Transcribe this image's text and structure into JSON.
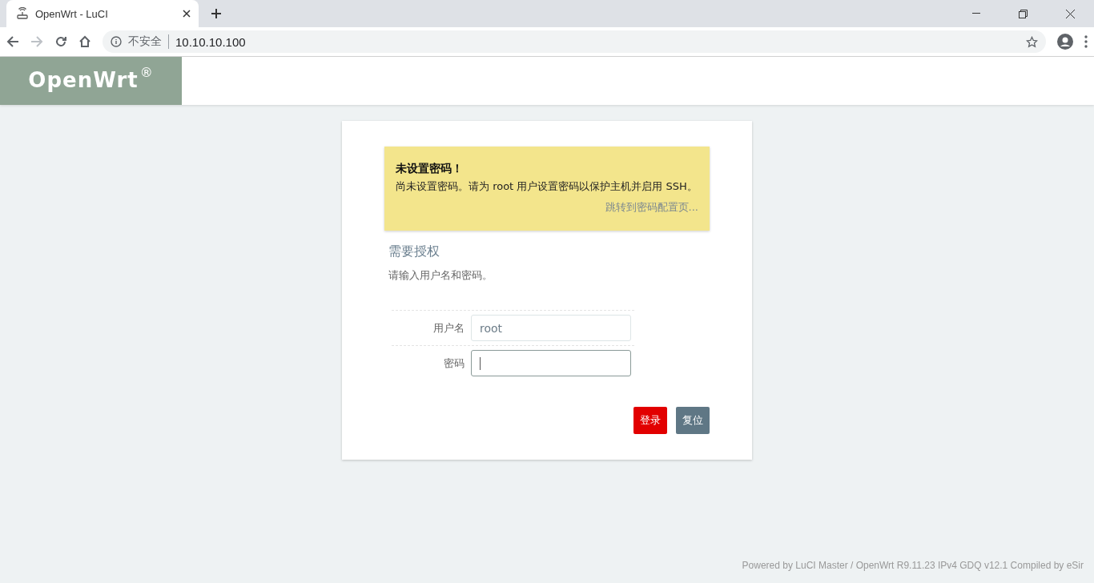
{
  "browser": {
    "tab_title": "OpenWrt - LuCI",
    "security_label": "不安全",
    "url": "10.10.10.100"
  },
  "header": {
    "logo": "OpenWrt",
    "logo_mark": "®"
  },
  "alert": {
    "title": "未设置密码！",
    "message": "尚未设置密码。请为 root 用户设置密码以保护主机并启用 SSH。",
    "link": "跳转到密码配置页..."
  },
  "auth": {
    "title": "需要授权",
    "description": "请输入用户名和密码。"
  },
  "fields": [
    {
      "label": "用户名",
      "kind": "text",
      "value": "root",
      "focused": false
    },
    {
      "label": "密码",
      "kind": "password",
      "focused": true
    }
  ],
  "buttons": [
    {
      "label": "登录",
      "kind": "primary"
    },
    {
      "label": "复位",
      "kind": "reset"
    }
  ],
  "footer": "Powered by LuCI Master / OpenWrt R9.11.23 IPv4 GDQ v12.1 Compiled by eSir"
}
